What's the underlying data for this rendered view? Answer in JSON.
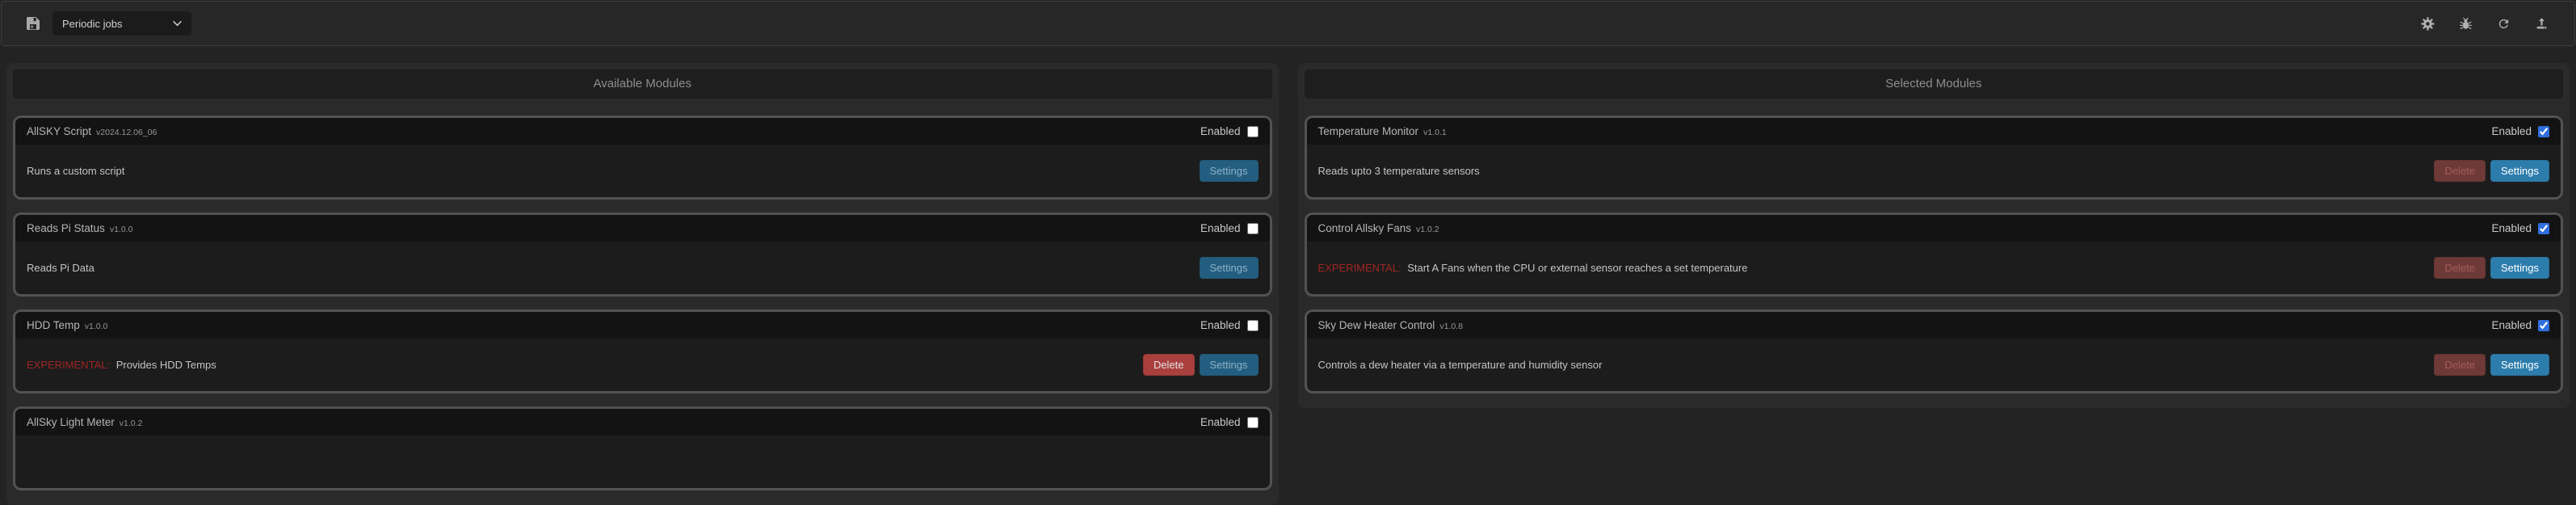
{
  "toolbar": {
    "jobs_dropdown": {
      "value": "Periodic jobs"
    },
    "icons": [
      {
        "name": "save-icon"
      },
      {
        "name": "settings-gear-icon"
      },
      {
        "name": "debug-bug-icon"
      },
      {
        "name": "reload-icon"
      },
      {
        "name": "upload-icon"
      }
    ]
  },
  "colors": {
    "settings_button_blue": "#2d7dac",
    "delete_button_red": "#aa403e",
    "experimental_red": "#9f2622",
    "checkbox_checked_blue": "#2f6fde"
  },
  "columns": [
    {
      "title": "Available Modules",
      "modules": [
        {
          "name": "AllSKY Script",
          "version": "v2024.12.06_06",
          "description": "Runs a custom script",
          "enabled_label": "Enabled",
          "enabled": false,
          "settings_label": "Settings"
        },
        {
          "name": "Reads Pi Status",
          "version": "v1.0.0",
          "description": "Reads Pi Data",
          "enabled_label": "Enabled",
          "enabled": false,
          "settings_label": "Settings"
        },
        {
          "name": "HDD Temp",
          "version": "v1.0.0",
          "experimental_label": "EXPERIMENTAL:",
          "description": "Provides HDD Temps",
          "enabled_label": "Enabled",
          "enabled": false,
          "delete_label": "Delete",
          "settings_label": "Settings"
        },
        {
          "name": "AllSky Light Meter",
          "version": "v1.0.2",
          "enabled_label": "Enabled",
          "enabled": false
        }
      ]
    },
    {
      "title": "Selected Modules",
      "modules": [
        {
          "name": "Temperature Monitor",
          "version": "v1.0.1",
          "description": "Reads upto 3 temperature sensors",
          "enabled_label": "Enabled",
          "enabled": true,
          "delete_label": "Delete",
          "settings_label": "Settings"
        },
        {
          "name": "Control Allsky Fans",
          "version": "v1.0.2",
          "experimental_label": "EXPERIMENTAL:",
          "description": "Start A Fans when the CPU or external sensor reaches a set temperature",
          "enabled_label": "Enabled",
          "enabled": true,
          "delete_label": "Delete",
          "settings_label": "Settings"
        },
        {
          "name": "Sky Dew Heater Control",
          "version": "v1.0.8",
          "description": "Controls a dew heater via a temperature and humidity sensor",
          "enabled_label": "Enabled",
          "enabled": true,
          "delete_label": "Delete",
          "settings_label": "Settings"
        }
      ]
    }
  ]
}
